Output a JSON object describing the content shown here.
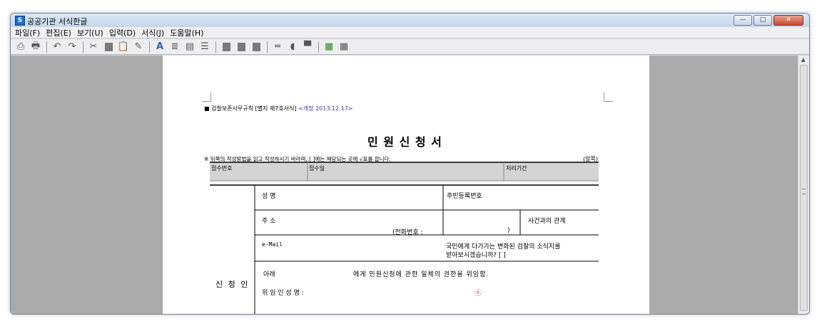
{
  "window": {
    "title": "공공기관 서식한글",
    "icon_label": "S",
    "buttons": {
      "minimize": "—",
      "maximize": "□",
      "close": "✕"
    }
  },
  "menu": [
    "파일(F)",
    "편집(E)",
    "보기(U)",
    "입력(D)",
    "서식(J)",
    "도움말(H)"
  ],
  "toolbar_icons": [
    "print-preview-icon",
    "print-icon",
    "undo-icon",
    "redo-icon",
    "cut-icon",
    "copy-icon",
    "paste-icon",
    "paste-special-icon",
    "font-icon",
    "align-icon",
    "style-icon",
    "list-icon",
    "fill-icon",
    "table-icon",
    "grid-icon"
  ],
  "document": {
    "rule_ref": "■ 검찰보존사무규칙 [별지 제7호서식]",
    "rule_rev": "<개정 2013.12.17>",
    "form_title": "민 원 신 청 서",
    "instructions": "※ 뒤쪽의 작성방법을 읽고 작성하시기 바라며, [  ]에는 해당되는 곳에 √표를 합니다.",
    "page_side": "(앞쪽)",
    "header_cells": {
      "receipt_no": "접수번호",
      "receipt_date": "접수일",
      "processing_period": "처리기간"
    },
    "rows": {
      "name": "성  명",
      "resident_no": "주민등록번호",
      "address": "주  소",
      "relation": "사건과의 관계",
      "phone": "(전화번호 :",
      "phone_close": ")",
      "email": "e-Mail",
      "news_q1": "국민에게 다가가는 변화된 검찰의 소식지를",
      "news_q2": "받아보시겠습니까? [  ]",
      "delegation_1": "아래",
      "delegation_2": "에게 민원신청에 관한 일체의 권한을 위임함.",
      "delegator": "위 임 인   성 명 :",
      "seal": "ⓔ",
      "applicant": "신 청 인"
    }
  },
  "colors": {
    "revision": "#3a3aa8",
    "seal": "#d23a3a",
    "table_header_bg": "#d4d4d4"
  }
}
